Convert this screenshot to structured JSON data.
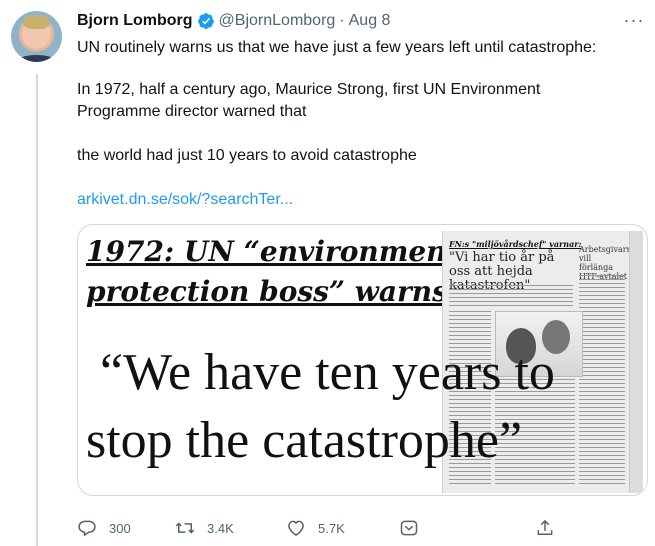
{
  "tweet": {
    "author_name": "Bjorn Lomborg",
    "handle": "@BjornLomborg",
    "separator": "·",
    "date": "Aug 8",
    "more_label": "···",
    "lines": {
      "l1": "UN routinely warns us that we have just a few years left until catastrophe:",
      "l2": "In 1972, half a century ago, Maurice Strong, first UN Environment",
      "l3": "Programme director warned that",
      "l4": "the world had just 10 years to avoid catastrophe",
      "link": "arkivet.dn.se/sok/?searchTer..."
    }
  },
  "media": {
    "headline_line1": "1972: UN “environment",
    "headline_line2": "protection boss” warns:",
    "quote_line1": "“We have ten years to",
    "quote_line2": "stop the catastrophe”",
    "clipping": {
      "tag": "FN:s \"miljövårdschef\" varnar:",
      "headline": "\"Vi har tio år på oss att hejda katastrofen\"",
      "side": "Arbetsgivarna vill förlänga HTF-avtalet"
    }
  },
  "actions": {
    "replies": "300",
    "retweets": "3.4K",
    "likes": "5.7K"
  },
  "colors": {
    "accent": "#1d9bf0",
    "secondary_text": "#536471",
    "primary_text": "#0f1419",
    "border": "#cfd9de"
  },
  "icons": [
    "verified-badge-icon",
    "more-icon",
    "reply-icon",
    "retweet-icon",
    "like-icon",
    "tip-jar-icon",
    "share-icon"
  ]
}
